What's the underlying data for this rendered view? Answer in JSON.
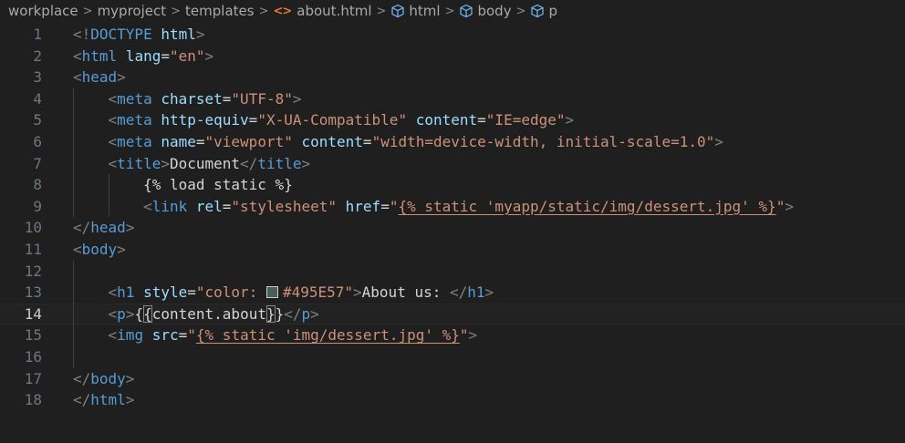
{
  "breadcrumb": {
    "items": [
      "workplace",
      "myproject",
      "templates",
      "about.html",
      "html",
      "body",
      "p"
    ],
    "separator": ">"
  },
  "editor": {
    "current_line": 14,
    "line_numbers": [
      "1",
      "2",
      "3",
      "4",
      "5",
      "6",
      "7",
      "8",
      "9",
      "10",
      "11",
      "12",
      "13",
      "14",
      "15",
      "16",
      "17",
      "18"
    ],
    "colors": {
      "background": "#1f1f1f",
      "tag": "#569cd6",
      "attribute": "#9cdcfe",
      "string": "#ce9178",
      "bracket": "#808080",
      "text": "#d4d4d4",
      "swatch": "#495E57"
    },
    "lines": [
      [
        [
          "t",
          "<!"
        ],
        [
          "n",
          "DOCTYPE"
        ],
        [
          "x",
          " "
        ],
        [
          "a",
          "html"
        ],
        [
          "t",
          ">"
        ]
      ],
      [
        [
          "t",
          "<"
        ],
        [
          "n",
          "html"
        ],
        [
          "x",
          " "
        ],
        [
          "a",
          "lang"
        ],
        [
          "x",
          "="
        ],
        [
          "s",
          "\"en\""
        ],
        [
          "t",
          ">"
        ]
      ],
      [
        [
          "t",
          "<"
        ],
        [
          "n",
          "head"
        ],
        [
          "t",
          ">"
        ]
      ],
      [
        [
          "x",
          "    "
        ],
        [
          "t",
          "<"
        ],
        [
          "n",
          "meta"
        ],
        [
          "x",
          " "
        ],
        [
          "a",
          "charset"
        ],
        [
          "x",
          "="
        ],
        [
          "s",
          "\"UTF-8\""
        ],
        [
          "t",
          ">"
        ]
      ],
      [
        [
          "x",
          "    "
        ],
        [
          "t",
          "<"
        ],
        [
          "n",
          "meta"
        ],
        [
          "x",
          " "
        ],
        [
          "a",
          "http-equiv"
        ],
        [
          "x",
          "="
        ],
        [
          "s",
          "\"X-UA-Compatible\""
        ],
        [
          "x",
          " "
        ],
        [
          "a",
          "content"
        ],
        [
          "x",
          "="
        ],
        [
          "s",
          "\"IE=edge\""
        ],
        [
          "t",
          ">"
        ]
      ],
      [
        [
          "x",
          "    "
        ],
        [
          "t",
          "<"
        ],
        [
          "n",
          "meta"
        ],
        [
          "x",
          " "
        ],
        [
          "a",
          "name"
        ],
        [
          "x",
          "="
        ],
        [
          "s",
          "\"viewport\""
        ],
        [
          "x",
          " "
        ],
        [
          "a",
          "content"
        ],
        [
          "x",
          "="
        ],
        [
          "s",
          "\"width=device-width, initial-scale=1.0\""
        ],
        [
          "t",
          ">"
        ]
      ],
      [
        [
          "x",
          "    "
        ],
        [
          "t",
          "<"
        ],
        [
          "n",
          "title"
        ],
        [
          "t",
          ">"
        ],
        [
          "x",
          "Document"
        ],
        [
          "t",
          "</"
        ],
        [
          "n",
          "title"
        ],
        [
          "t",
          ">"
        ]
      ],
      [
        [
          "x",
          "        {% load static %}"
        ]
      ],
      [
        [
          "x",
          "        "
        ],
        [
          "t",
          "<"
        ],
        [
          "n",
          "link"
        ],
        [
          "x",
          " "
        ],
        [
          "a",
          "rel"
        ],
        [
          "x",
          "="
        ],
        [
          "s",
          "\"stylesheet\""
        ],
        [
          "x",
          " "
        ],
        [
          "a",
          "href"
        ],
        [
          "x",
          "="
        ],
        [
          "s",
          "\""
        ],
        [
          "su",
          "{% static 'myapp/static/img/dessert.jpg' %}"
        ],
        [
          "s",
          "\""
        ],
        [
          "t",
          ">"
        ]
      ],
      [
        [
          "t",
          "</"
        ],
        [
          "n",
          "head"
        ],
        [
          "t",
          ">"
        ]
      ],
      [
        [
          "t",
          "<"
        ],
        [
          "n",
          "body"
        ],
        [
          "t",
          ">"
        ]
      ],
      [],
      [
        [
          "x",
          "    "
        ],
        [
          "t",
          "<"
        ],
        [
          "n",
          "h1"
        ],
        [
          "x",
          " "
        ],
        [
          "a",
          "style"
        ],
        [
          "x",
          "="
        ],
        [
          "s",
          "\"color: "
        ],
        [
          "sw",
          ""
        ],
        [
          "s",
          "#495E57\""
        ],
        [
          "t",
          ">"
        ],
        [
          "x",
          "About us: "
        ],
        [
          "t",
          "</"
        ],
        [
          "n",
          "h1"
        ],
        [
          "t",
          ">"
        ]
      ],
      [
        [
          "x",
          "    "
        ],
        [
          "t",
          "<"
        ],
        [
          "n",
          "p"
        ],
        [
          "t",
          ">"
        ],
        [
          "x",
          "{"
        ],
        [
          "xb",
          "{"
        ],
        [
          "x",
          "content.about"
        ],
        [
          "xb",
          "}"
        ],
        [
          "x",
          "}"
        ],
        [
          "t",
          "</"
        ],
        [
          "n",
          "p"
        ],
        [
          "t",
          ">"
        ]
      ],
      [
        [
          "x",
          "    "
        ],
        [
          "t",
          "<"
        ],
        [
          "n",
          "img"
        ],
        [
          "x",
          " "
        ],
        [
          "a",
          "src"
        ],
        [
          "x",
          "="
        ],
        [
          "s",
          "\""
        ],
        [
          "su",
          "{% static 'img/dessert.jpg' %}"
        ],
        [
          "s",
          "\""
        ],
        [
          "t",
          ">"
        ]
      ],
      [],
      [
        [
          "t",
          "</"
        ],
        [
          "n",
          "body"
        ],
        [
          "t",
          ">"
        ]
      ],
      [
        [
          "t",
          "</"
        ],
        [
          "n",
          "html"
        ],
        [
          "t",
          ">"
        ]
      ]
    ]
  }
}
